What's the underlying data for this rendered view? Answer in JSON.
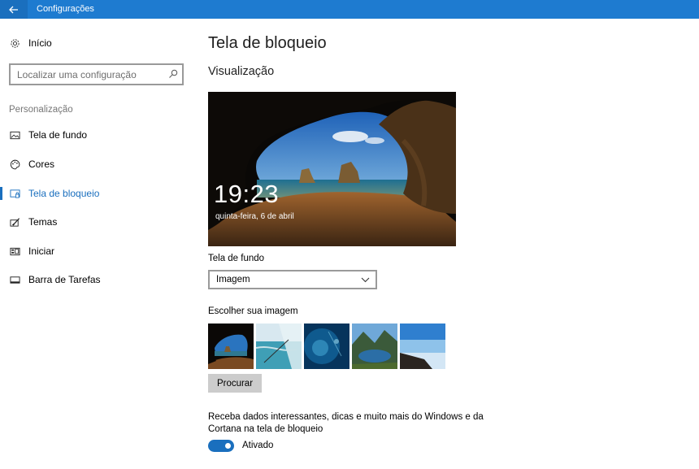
{
  "window": {
    "title": "Configurações"
  },
  "sidebar": {
    "home_label": "Início",
    "search_placeholder": "Localizar uma configuração",
    "section_label": "Personalização",
    "items": [
      {
        "label": "Tela de fundo",
        "icon": "picture-icon"
      },
      {
        "label": "Cores",
        "icon": "palette-icon"
      },
      {
        "label": "Tela de bloqueio",
        "icon": "lock-screen-icon",
        "selected": true
      },
      {
        "label": "Temas",
        "icon": "brush-icon"
      },
      {
        "label": "Iniciar",
        "icon": "start-icon"
      },
      {
        "label": "Barra de Tarefas",
        "icon": "taskbar-icon"
      }
    ]
  },
  "main": {
    "title": "Tela de bloqueio",
    "preview_heading": "Visualização",
    "preview": {
      "time": "19:23",
      "date": "quinta-feira, 6 de abril"
    },
    "background_label": "Tela de fundo",
    "background_value": "Imagem",
    "choose_image_label": "Escolher sua imagem",
    "browse_label": "Procurar",
    "tips_text": "Receba dados interessantes, dicas e muito mais do Windows e da Cortana na tela de bloqueio",
    "tips_toggle_state": "Ativado"
  },
  "colors": {
    "accent": "#1a6fbe",
    "titlebar": "#1e7bd0"
  }
}
